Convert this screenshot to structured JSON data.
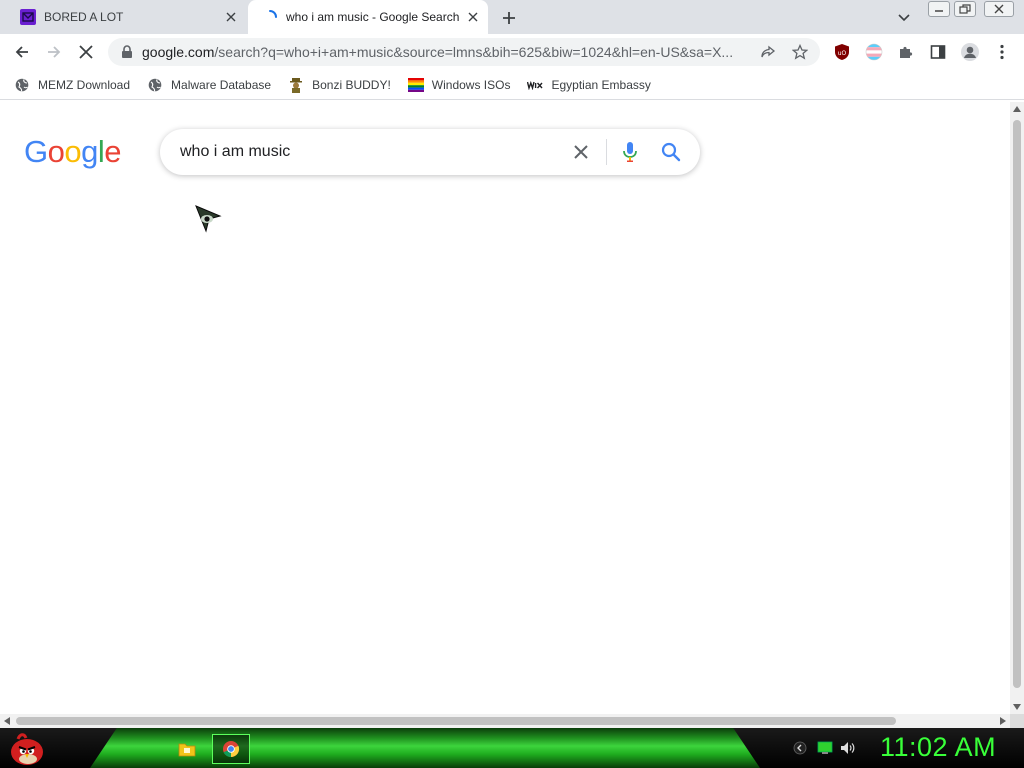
{
  "browser": {
    "tabs": [
      {
        "title": "BORED A LOT",
        "favicon": "purple-mail-icon",
        "active": false
      },
      {
        "title": "who i am music - Google Search",
        "favicon": "loading-spinner-icon",
        "active": true
      }
    ],
    "url": {
      "host": "google.com",
      "path": "/search?q=who+i+am+music&source=lmns&bih=625&biw=1024&hl=en-US&sa=X..."
    }
  },
  "bookmarks": [
    {
      "label": "MEMZ Download",
      "icon": "globe-icon"
    },
    {
      "label": "Malware Database",
      "icon": "globe-icon"
    },
    {
      "label": "Bonzi BUDDY!",
      "icon": "bonzi-icon"
    },
    {
      "label": "Windows ISOs",
      "icon": "rainbow-flag-icon"
    },
    {
      "label": "Egyptian Embassy",
      "icon": "wix-icon"
    }
  ],
  "page": {
    "logo": "Google",
    "search_value": "who i am music"
  },
  "taskbar": {
    "clock": "11:02 AM"
  },
  "colors": {
    "google_blue": "#4285f4",
    "google_red": "#ea4335",
    "google_yellow": "#fbbc05",
    "google_green": "#34a853",
    "clock_green": "#39ff39"
  }
}
